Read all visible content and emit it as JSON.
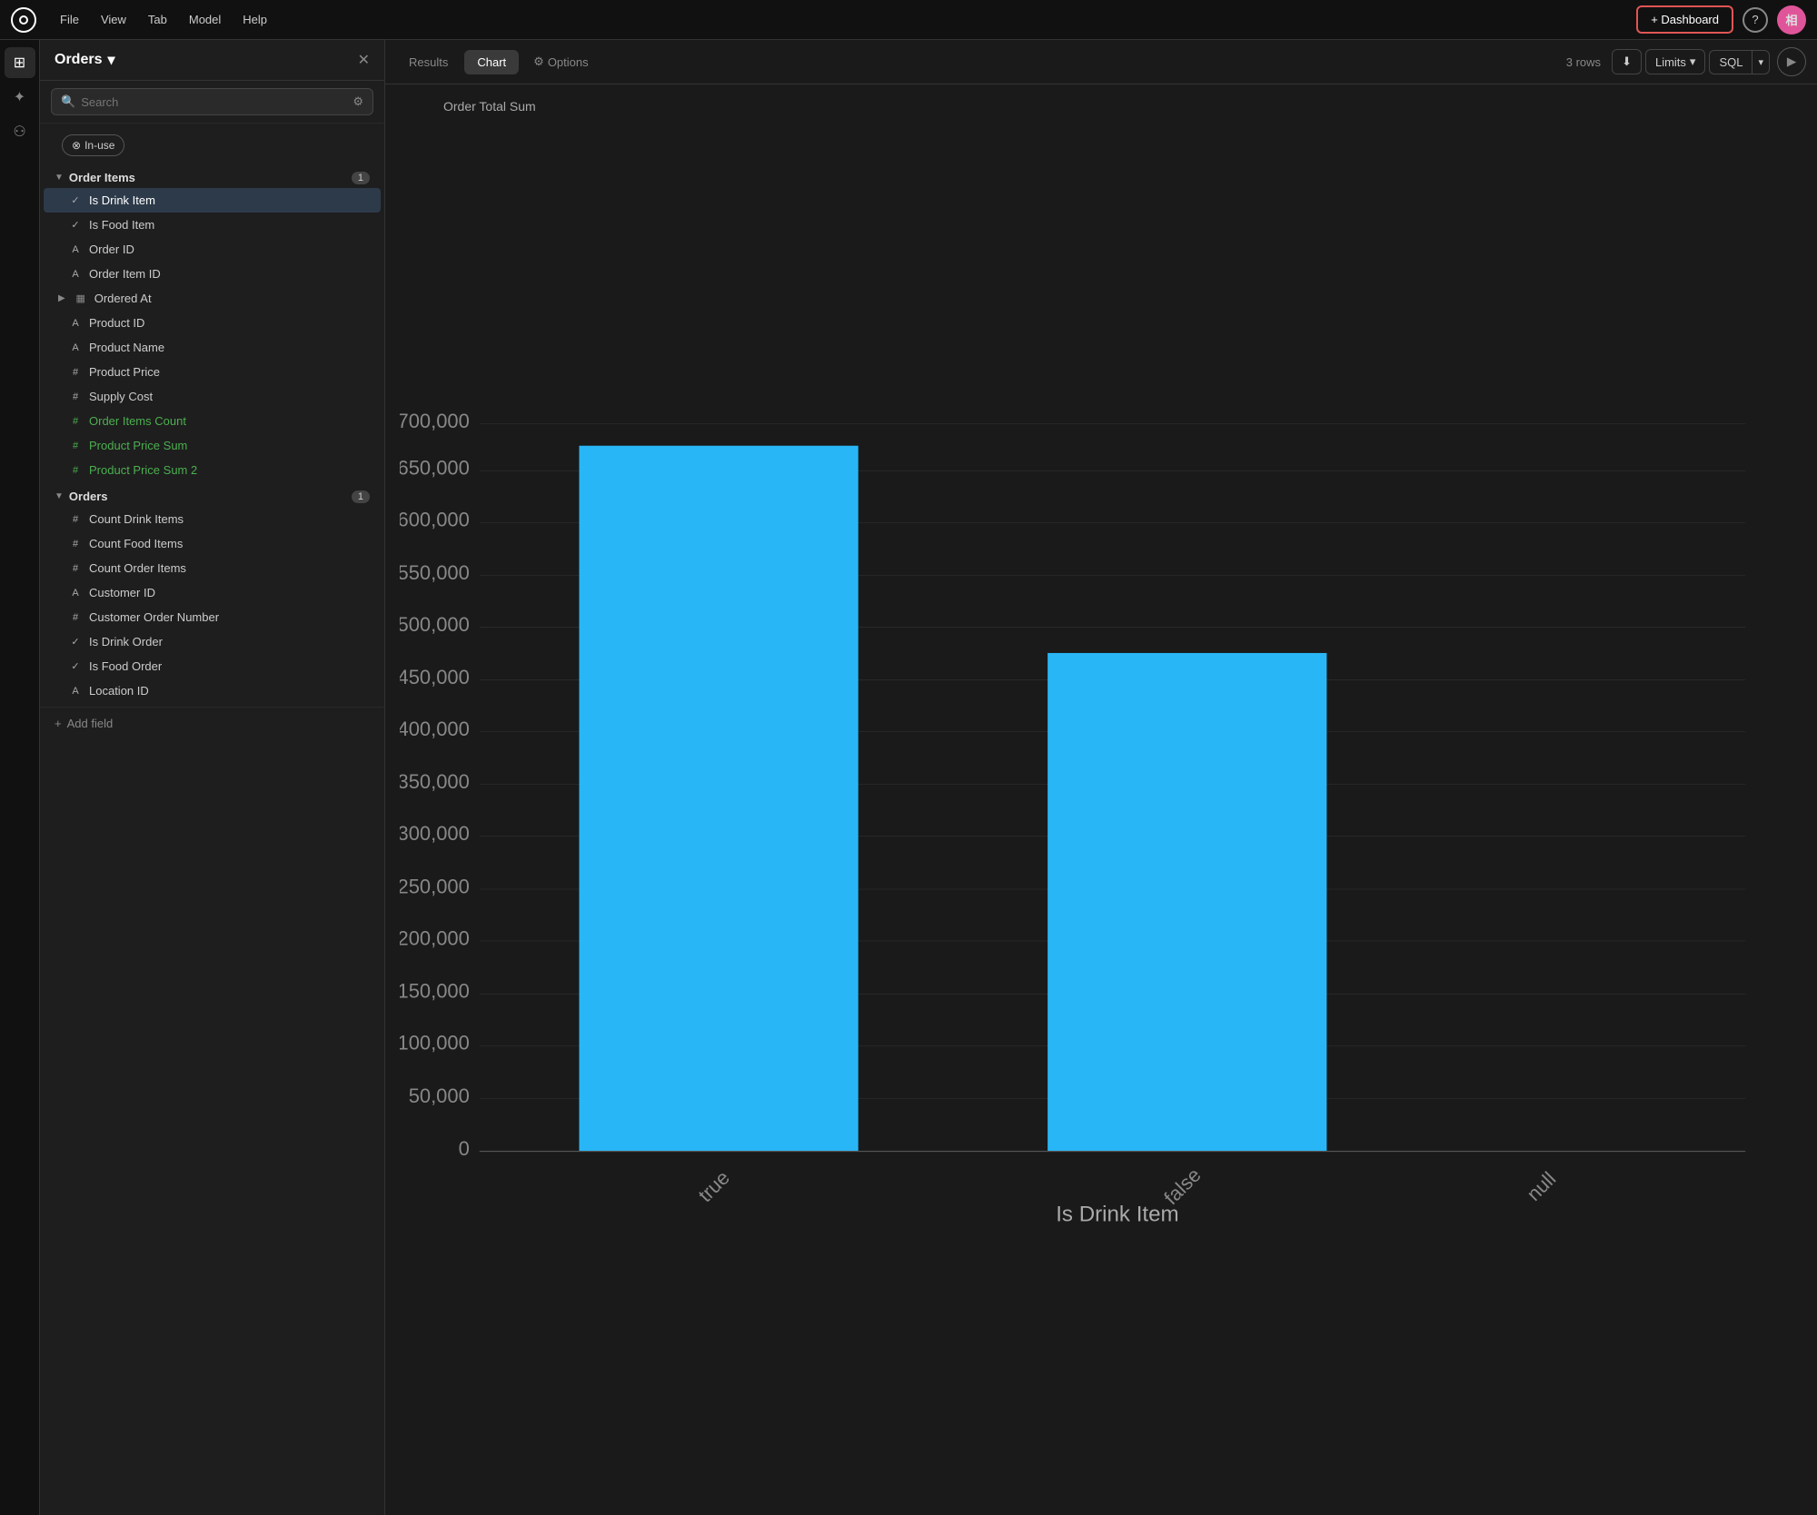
{
  "menubar": {
    "logo_title": "App Logo",
    "menu_items": [
      "File",
      "View",
      "Tab",
      "Model",
      "Help"
    ],
    "dashboard_btn": "+ Dashboard",
    "help_btn": "?",
    "avatar": "相"
  },
  "icon_sidebar": {
    "icons": [
      {
        "name": "grid-icon",
        "symbol": "⊞"
      },
      {
        "name": "sparkle-icon",
        "symbol": "✦"
      },
      {
        "name": "connections-icon",
        "symbol": "⚇"
      }
    ]
  },
  "panel": {
    "title": "Orders",
    "search_placeholder": "Search",
    "in_use_label": "In-use",
    "sections": [
      {
        "name": "Order Items",
        "badge": "1",
        "fields": [
          {
            "icon": "check",
            "label": "Is Drink Item",
            "active": true
          },
          {
            "icon": "check",
            "label": "Is Food Item"
          },
          {
            "icon": "string",
            "label": "Order ID"
          },
          {
            "icon": "string",
            "label": "Order Item ID"
          },
          {
            "icon": "table",
            "label": "Ordered At",
            "expandable": true
          },
          {
            "icon": "string",
            "label": "Product ID"
          },
          {
            "icon": "string",
            "label": "Product Name"
          },
          {
            "icon": "number",
            "label": "Product Price"
          },
          {
            "icon": "number",
            "label": "Supply Cost"
          },
          {
            "icon": "measure",
            "label": "Order Items Count"
          },
          {
            "icon": "measure",
            "label": "Product Price Sum"
          },
          {
            "icon": "measure",
            "label": "Product Price Sum 2"
          }
        ]
      },
      {
        "name": "Orders",
        "badge": "1",
        "fields": [
          {
            "icon": "number",
            "label": "Count Drink Items"
          },
          {
            "icon": "number",
            "label": "Count Food Items"
          },
          {
            "icon": "number",
            "label": "Count Order Items"
          },
          {
            "icon": "string",
            "label": "Customer ID"
          },
          {
            "icon": "number",
            "label": "Customer Order Number"
          },
          {
            "icon": "check",
            "label": "Is Drink Order"
          },
          {
            "icon": "check",
            "label": "Is Food Order"
          },
          {
            "icon": "string",
            "label": "Location ID"
          }
        ]
      }
    ],
    "add_field_label": "Add field"
  },
  "tabs": {
    "results_label": "Results",
    "chart_label": "Chart",
    "options_label": "Options",
    "rows_info": "3 rows",
    "limits_label": "Limits",
    "sql_label": "SQL"
  },
  "chart": {
    "title": "Order Total Sum",
    "x_axis_label": "Is Drink Item",
    "y_axis_labels": [
      "0",
      "50,000",
      "100,000",
      "150,000",
      "200,000",
      "250,000",
      "300,000",
      "350,000",
      "400,000",
      "450,000",
      "500,000",
      "550,000",
      "600,000",
      "650,000",
      "700,000"
    ],
    "bars": [
      {
        "label": "true",
        "value": 680000,
        "max": 700000
      },
      {
        "label": "false",
        "value": 480000,
        "max": 700000
      },
      {
        "label": "null",
        "value": 0,
        "max": 700000
      }
    ],
    "bar_color": "#29b6f6"
  }
}
